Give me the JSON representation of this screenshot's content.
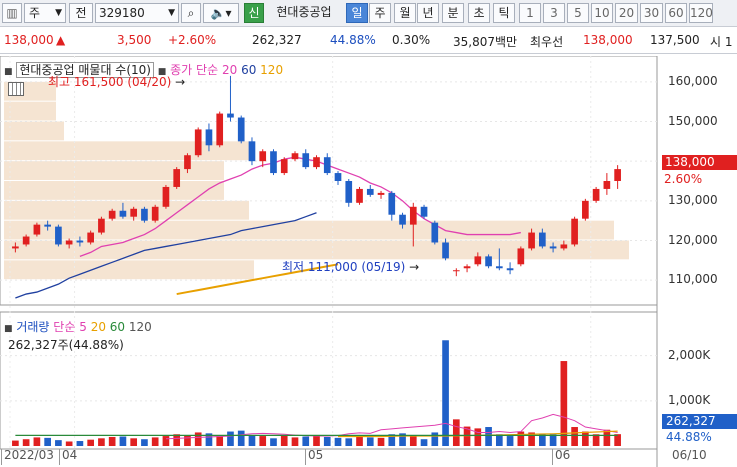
{
  "toolbar": {
    "market_select": "주",
    "prev_label": "전",
    "code": "329180",
    "new_badge": "신",
    "stock_name": "현대중공업",
    "periods": [
      "일",
      "주",
      "월",
      "년",
      "분",
      "초",
      "틱"
    ],
    "active_period": "일",
    "intervals": [
      "1",
      "3",
      "5",
      "10",
      "20",
      "30",
      "60",
      "120"
    ]
  },
  "quote": {
    "price": "138,000",
    "change_arrow": "▲",
    "change": "3,500",
    "change_pct": "+2.60%",
    "volume": "262,327",
    "volume_ratio": "44.88%",
    "turnover": "0.30%",
    "amount": "35,807백만",
    "best_label": "최우선",
    "ask": "138,000",
    "bid": "137,500",
    "tail": "시 1"
  },
  "price_panel": {
    "legend_title": "현대중공업 매물대 수(10)",
    "legend_close": "종가 단순",
    "legend_ma": [
      "20",
      "60",
      "120"
    ],
    "high_label": "최고 161,500 (04/20)",
    "low_label": "최저 111,000 (05/19)",
    "last_price_tag": "138,000",
    "last_pct_tag": "2.60%",
    "y_ticks": [
      "160,000",
      "150,000",
      "140,000",
      "130,000",
      "120,000",
      "110,000"
    ]
  },
  "volume_panel": {
    "legend_title": "거래량",
    "legend_ma_label": "단순",
    "legend_ma": [
      "5",
      "20",
      "60",
      "120"
    ],
    "volume_text": "262,327주(44.88%)",
    "y_ticks": [
      "2,000K",
      "1,000K"
    ],
    "last_volume_tag": "262,327",
    "last_pct_tag": "44.88%"
  },
  "x_axis": {
    "labels": [
      "2022/03",
      "04",
      "05",
      "06",
      "06/10"
    ]
  },
  "colors": {
    "up": "#e02020",
    "down": "#2060c8",
    "ma20": "#e040b0",
    "ma60": "#2040a0",
    "ma120": "#e8a000",
    "profile": "#f5e4d2"
  },
  "chart_data": {
    "type": "candlestick",
    "price_range": [
      105000,
      165000
    ],
    "candles": [
      {
        "o": 118000,
        "h": 119500,
        "l": 117000,
        "c": 118500
      },
      {
        "o": 119000,
        "h": 121500,
        "l": 118500,
        "c": 121000
      },
      {
        "o": 121500,
        "h": 124500,
        "l": 121000,
        "c": 124000
      },
      {
        "o": 124000,
        "h": 125000,
        "l": 122500,
        "c": 123500
      },
      {
        "o": 123500,
        "h": 124000,
        "l": 118500,
        "c": 119000
      },
      {
        "o": 119000,
        "h": 120500,
        "l": 118000,
        "c": 120000
      },
      {
        "o": 120000,
        "h": 121000,
        "l": 118500,
        "c": 119500
      },
      {
        "o": 119500,
        "h": 122500,
        "l": 119000,
        "c": 122000
      },
      {
        "o": 122000,
        "h": 126000,
        "l": 121500,
        "c": 125500
      },
      {
        "o": 125500,
        "h": 128000,
        "l": 125000,
        "c": 127500
      },
      {
        "o": 127500,
        "h": 129500,
        "l": 125500,
        "c": 126000
      },
      {
        "o": 126000,
        "h": 128500,
        "l": 125000,
        "c": 128000
      },
      {
        "o": 128000,
        "h": 128500,
        "l": 124500,
        "c": 125000
      },
      {
        "o": 125000,
        "h": 129000,
        "l": 124500,
        "c": 128500
      },
      {
        "o": 128500,
        "h": 134000,
        "l": 128000,
        "c": 133500
      },
      {
        "o": 133500,
        "h": 138500,
        "l": 133000,
        "c": 138000
      },
      {
        "o": 138000,
        "h": 142000,
        "l": 137000,
        "c": 141500
      },
      {
        "o": 141500,
        "h": 148500,
        "l": 141000,
        "c": 148000
      },
      {
        "o": 148000,
        "h": 149500,
        "l": 142500,
        "c": 144000
      },
      {
        "o": 144000,
        "h": 152500,
        "l": 143500,
        "c": 152000
      },
      {
        "o": 152000,
        "h": 161500,
        "l": 150000,
        "c": 151000
      },
      {
        "o": 151000,
        "h": 151500,
        "l": 144500,
        "c": 145000
      },
      {
        "o": 145000,
        "h": 146000,
        "l": 139000,
        "c": 140000
      },
      {
        "o": 140000,
        "h": 143000,
        "l": 138500,
        "c": 142500
      },
      {
        "o": 142500,
        "h": 143000,
        "l": 136500,
        "c": 137000
      },
      {
        "o": 137000,
        "h": 141000,
        "l": 136500,
        "c": 140500
      },
      {
        "o": 140500,
        "h": 142500,
        "l": 140000,
        "c": 142000
      },
      {
        "o": 142000,
        "h": 143000,
        "l": 138000,
        "c": 138500
      },
      {
        "o": 138500,
        "h": 141500,
        "l": 138000,
        "c": 141000
      },
      {
        "o": 141000,
        "h": 142000,
        "l": 136500,
        "c": 137000
      },
      {
        "o": 137000,
        "h": 137500,
        "l": 134000,
        "c": 135000
      },
      {
        "o": 135000,
        "h": 135500,
        "l": 128500,
        "c": 129500
      },
      {
        "o": 129500,
        "h": 133500,
        "l": 129000,
        "c": 133000
      },
      {
        "o": 133000,
        "h": 134000,
        "l": 131000,
        "c": 131500
      },
      {
        "o": 131500,
        "h": 132500,
        "l": 130500,
        "c": 132000
      },
      {
        "o": 132000,
        "h": 132500,
        "l": 125000,
        "c": 126500
      },
      {
        "o": 126500,
        "h": 127000,
        "l": 123000,
        "c": 124000
      },
      {
        "o": 124000,
        "h": 129500,
        "l": 118500,
        "c": 128500
      },
      {
        "o": 128500,
        "h": 129000,
        "l": 125500,
        "c": 126000
      },
      {
        "o": 124500,
        "h": 125000,
        "l": 119000,
        "c": 119500
      },
      {
        "o": 119500,
        "h": 120500,
        "l": 115000,
        "c": 115500
      },
      {
        "o": 112500,
        "h": 113000,
        "l": 111000,
        "c": 112500
      },
      {
        "o": 113000,
        "h": 114000,
        "l": 112000,
        "c": 113500
      },
      {
        "o": 114000,
        "h": 117000,
        "l": 113500,
        "c": 116000
      },
      {
        "o": 116000,
        "h": 116500,
        "l": 113000,
        "c": 113500
      },
      {
        "o": 113500,
        "h": 118000,
        "l": 112500,
        "c": 113000
      },
      {
        "o": 113000,
        "h": 114500,
        "l": 111500,
        "c": 112500
      },
      {
        "o": 114000,
        "h": 118500,
        "l": 113500,
        "c": 118000
      },
      {
        "o": 118000,
        "h": 123000,
        "l": 117500,
        "c": 122000
      },
      {
        "o": 122000,
        "h": 123000,
        "l": 118000,
        "c": 118500
      },
      {
        "o": 118500,
        "h": 119500,
        "l": 117000,
        "c": 118000
      },
      {
        "o": 118000,
        "h": 120000,
        "l": 117500,
        "c": 119000
      },
      {
        "o": 119000,
        "h": 126000,
        "l": 118500,
        "c": 125500
      },
      {
        "o": 125500,
        "h": 130500,
        "l": 125000,
        "c": 130000
      },
      {
        "o": 130000,
        "h": 133500,
        "l": 129500,
        "c": 133000
      },
      {
        "o": 133000,
        "h": 137000,
        "l": 131500,
        "c": 135000
      },
      {
        "o": 135000,
        "h": 139000,
        "l": 133000,
        "c": 138000
      }
    ],
    "ma20": [
      116000,
      117000,
      118500,
      119000,
      119500,
      120500,
      121500,
      123000,
      125000,
      127000,
      129000,
      131000,
      133000,
      134500,
      135500,
      136500,
      138000,
      139000,
      139500,
      140500,
      141000,
      140500,
      140000,
      139000,
      138000,
      137000,
      136000,
      134500,
      133500,
      132000,
      130000,
      127500,
      125500,
      124000,
      122500,
      122000,
      121500,
      121500,
      121500,
      121500,
      121500,
      122000
    ],
    "ma20_start": 6,
    "ma60": [
      105500,
      106500,
      107000,
      108000,
      109000,
      110500,
      111500,
      112500,
      113500,
      114500,
      115500,
      116500,
      117500,
      118000,
      118500,
      119000,
      119500,
      120000,
      120500,
      121000,
      121500,
      122500,
      123000,
      123500,
      124000,
      124500,
      125000,
      126000,
      127000
    ],
    "ma60_start": 0,
    "ma120": [
      106500,
      107000,
      107500,
      108000,
      108500,
      109000,
      109500,
      110000,
      110500,
      111000,
      111500,
      112000,
      112500,
      113000,
      113500,
      114000
    ],
    "ma120_start": 15,
    "volume_range": [
      0,
      2700
    ],
    "volumes_k": [
      120,
      150,
      190,
      180,
      130,
      100,
      110,
      140,
      170,
      200,
      210,
      170,
      150,
      190,
      220,
      260,
      230,
      300,
      280,
      220,
      320,
      340,
      240,
      220,
      170,
      230,
      190,
      210,
      220,
      200,
      180,
      170,
      240,
      190,
      180,
      260,
      280,
      230,
      150,
      300,
      2340,
      590,
      430,
      390,
      420,
      260,
      220,
      320,
      300,
      260,
      260,
      1880,
      420,
      320,
      260,
      360,
      262
    ],
    "volume_ma5": [
      160,
      170,
      180,
      190,
      200,
      210,
      220,
      250,
      270,
      280,
      270,
      260,
      240,
      230,
      220,
      220,
      230,
      270,
      290,
      280,
      360,
      380,
      400,
      420,
      440,
      460,
      500,
      430,
      380,
      300,
      300,
      320,
      300,
      320,
      560,
      620,
      700,
      640,
      560,
      420,
      380,
      340,
      300
    ],
    "volume_ma5_start": 14,
    "volume_ma20": [
      210,
      210,
      210,
      210,
      210,
      215,
      220,
      220,
      220,
      220,
      220,
      225,
      230,
      235,
      240,
      245,
      250,
      255,
      260,
      265,
      270,
      280,
      290,
      300,
      310,
      320,
      330
    ],
    "volume_ma20_start": 30
  }
}
